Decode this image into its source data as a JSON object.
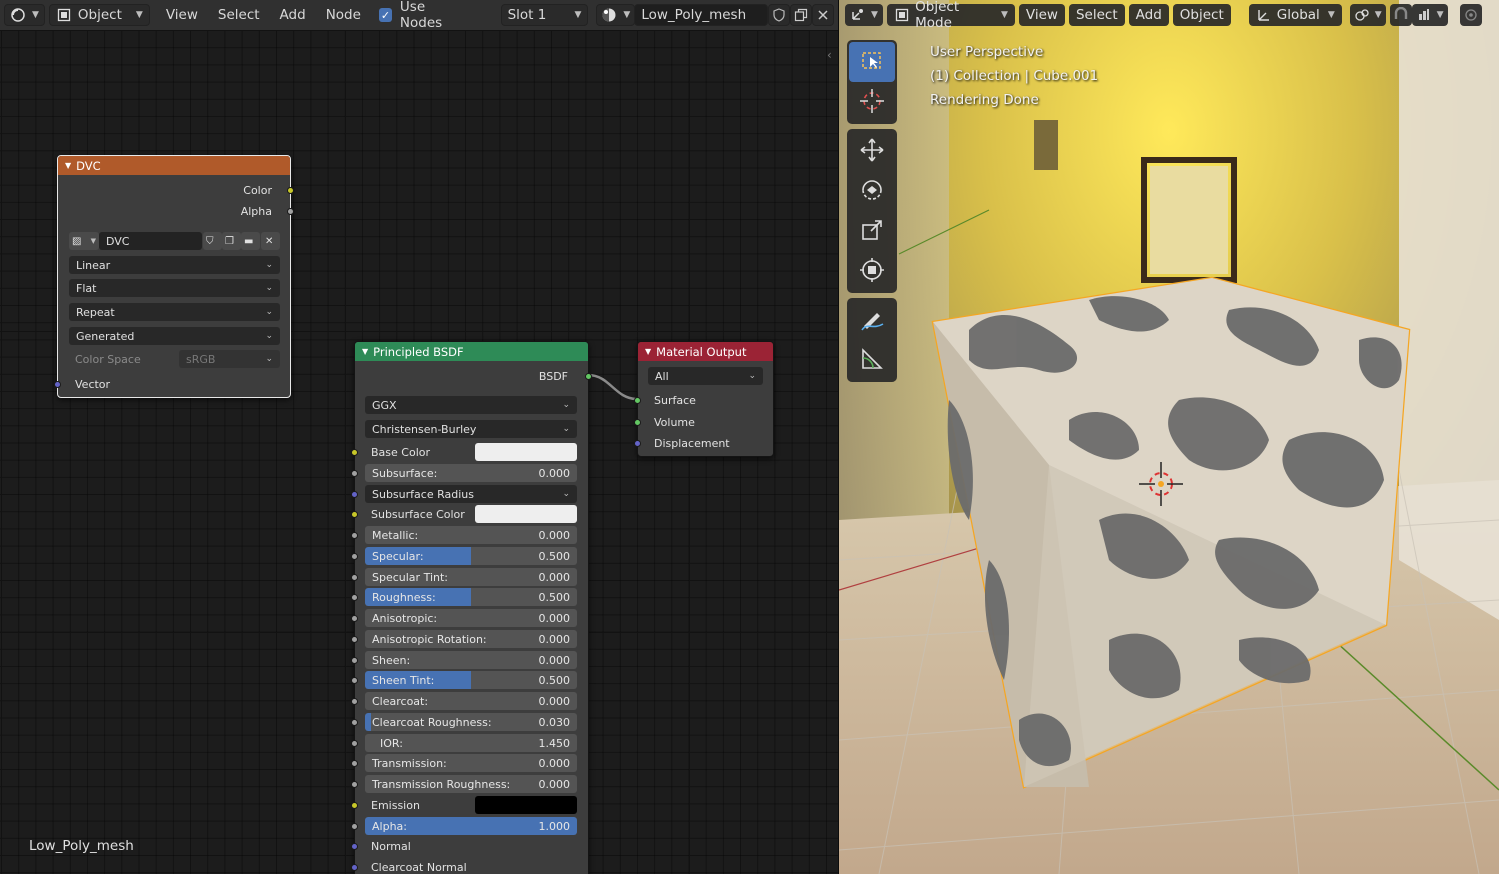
{
  "node_header": {
    "editor_type_icon": "node-editor-icon",
    "object_label": "Object",
    "view": "View",
    "select": "Select",
    "add": "Add",
    "node": "Node",
    "use_nodes_label": "Use Nodes",
    "slot_label": "Slot 1",
    "material_name": "Low_Poly_mesh"
  },
  "canvas": {
    "object_name": "Low_Poly_mesh"
  },
  "node_dvc": {
    "title": "DVC",
    "out_color": "Color",
    "out_alpha": "Alpha",
    "image_name": "DVC",
    "interpolation": "Linear",
    "projection": "Flat",
    "extension": "Repeat",
    "source": "Generated",
    "color_space_label": "Color Space",
    "color_space_value": "sRGB",
    "in_vector": "Vector",
    "header_color": "#b05a2a"
  },
  "node_bsdf": {
    "title": "Principled BSDF",
    "out_bsdf": "BSDF",
    "distribution": "GGX",
    "subsurface_method": "Christensen-Burley",
    "header_color": "#2e8b57",
    "inputs": [
      {
        "label": "Base Color",
        "kind": "color",
        "color": "#eeeeee",
        "socket": "yellow"
      },
      {
        "label": "Subsurface:",
        "value": "0.000",
        "fraction": 0,
        "socket": "grey"
      },
      {
        "label": "Subsurface Radius",
        "kind": "dropdown",
        "socket": "blue"
      },
      {
        "label": "Subsurface Color",
        "kind": "color",
        "color": "#eeeeee",
        "socket": "yellow"
      },
      {
        "label": "Metallic:",
        "value": "0.000",
        "fraction": 0,
        "socket": "grey"
      },
      {
        "label": "Specular:",
        "value": "0.500",
        "fraction": 0.5,
        "socket": "grey"
      },
      {
        "label": "Specular Tint:",
        "value": "0.000",
        "fraction": 0,
        "socket": "grey"
      },
      {
        "label": "Roughness:",
        "value": "0.500",
        "fraction": 0.5,
        "socket": "grey"
      },
      {
        "label": "Anisotropic:",
        "value": "0.000",
        "fraction": 0,
        "socket": "grey"
      },
      {
        "label": "Anisotropic Rotation:",
        "value": "0.000",
        "fraction": 0,
        "socket": "grey"
      },
      {
        "label": "Sheen:",
        "value": "0.000",
        "fraction": 0,
        "socket": "grey"
      },
      {
        "label": "Sheen Tint:",
        "value": "0.500",
        "fraction": 0.5,
        "socket": "grey"
      },
      {
        "label": "Clearcoat:",
        "value": "0.000",
        "fraction": 0,
        "socket": "grey"
      },
      {
        "label": "Clearcoat Roughness:",
        "value": "0.030",
        "fraction": 0.03,
        "socket": "grey"
      },
      {
        "label": "IOR:",
        "value": "1.450",
        "fraction": 0,
        "socket": "grey"
      },
      {
        "label": "Transmission:",
        "value": "0.000",
        "fraction": 0,
        "socket": "grey"
      },
      {
        "label": "Transmission Roughness:",
        "value": "0.000",
        "fraction": 0,
        "socket": "grey"
      },
      {
        "label": "Emission",
        "kind": "color",
        "color": "#000000",
        "socket": "yellow"
      },
      {
        "label": "Alpha:",
        "value": "1.000",
        "fraction": 1,
        "socket": "grey"
      },
      {
        "label": "Normal",
        "kind": "plain",
        "socket": "blue"
      },
      {
        "label": "Clearcoat Normal",
        "kind": "plain",
        "socket": "blue"
      }
    ]
  },
  "node_output": {
    "title": "Material Output",
    "target": "All",
    "in_surface": "Surface",
    "in_volume": "Volume",
    "in_displacement": "Displacement",
    "header_color": "#9b2335"
  },
  "vp_header": {
    "editor_type_icon": "3d-viewport-icon",
    "mode_label": "Object Mode",
    "view": "View",
    "select": "Select",
    "add": "Add",
    "object": "Object",
    "orientation": "Global"
  },
  "overlay": {
    "line1": "User Perspective",
    "line2": "(1) Collection | Cube.001",
    "line3": "Rendering Done"
  },
  "tools": [
    "select-box-icon",
    "cursor-icon",
    "move-icon",
    "rotate-icon",
    "scale-icon",
    "transform-icon",
    "annotate-icon",
    "measure-icon"
  ],
  "colors": {
    "accent": "#4772b3",
    "selection_outline": "#f5a623"
  }
}
